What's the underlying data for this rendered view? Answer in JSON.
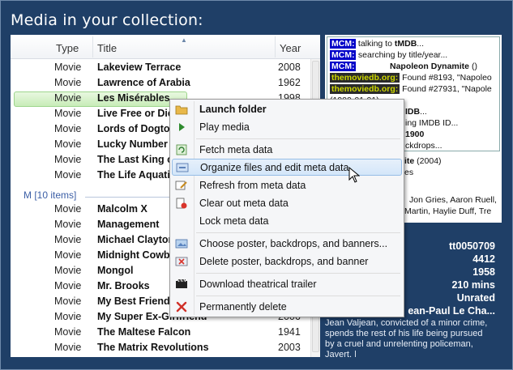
{
  "header": {
    "title": "Media in your collection:"
  },
  "list": {
    "columns": {
      "type": "Type",
      "title": "Title",
      "year": "Year"
    },
    "rows_top": [
      {
        "type": "Movie",
        "title": "Lakeview Terrace",
        "year": "2008"
      },
      {
        "type": "Movie",
        "title": "Lawrence of Arabia",
        "year": "1962"
      },
      {
        "type": "Movie",
        "title": "Les Misérables",
        "year": "1998"
      },
      {
        "type": "Movie",
        "title": "Live Free or Die",
        "year": ""
      },
      {
        "type": "Movie",
        "title": "Lords of Dogtown",
        "year": ""
      },
      {
        "type": "Movie",
        "title": "Lucky Number",
        "year": ""
      },
      {
        "type": "Movie",
        "title": "The Last King of",
        "year": ""
      },
      {
        "type": "Movie",
        "title": "The Life Aquatic",
        "year": ""
      }
    ],
    "group_label": "M [10 items]",
    "rows_bottom": [
      {
        "type": "Movie",
        "title": "Malcolm X",
        "year": ""
      },
      {
        "type": "Movie",
        "title": "Management",
        "year": ""
      },
      {
        "type": "Movie",
        "title": "Michael Clayton",
        "year": ""
      },
      {
        "type": "Movie",
        "title": "Midnight Cowboy",
        "year": ""
      },
      {
        "type": "Movie",
        "title": "Mongol",
        "year": ""
      },
      {
        "type": "Movie",
        "title": "Mr. Brooks",
        "year": ""
      },
      {
        "type": "Movie",
        "title": "My Best Friend",
        "year": ""
      },
      {
        "type": "Movie",
        "title": "My Super Ex-Girlfriend",
        "year": "2006"
      },
      {
        "type": "Movie",
        "title": "The Maltese Falcon",
        "year": "1941"
      },
      {
        "type": "Movie",
        "title": "The Matrix Revolutions",
        "year": "2003"
      }
    ]
  },
  "context_menu": {
    "items": [
      {
        "label": "Launch folder",
        "icon": "folder-icon"
      },
      {
        "label": "Play media",
        "icon": "play-icon"
      },
      {
        "label": "Fetch meta data",
        "icon": "refresh-icon"
      },
      {
        "label": "Organize files and edit meta data",
        "icon": "organize-icon"
      },
      {
        "label": "Refresh from meta data",
        "icon": "edit-icon"
      },
      {
        "label": "Clear out meta data",
        "icon": "clear-icon"
      },
      {
        "label": "Lock meta data",
        "icon": ""
      },
      {
        "label": "Choose poster, backdrops, and banners...",
        "icon": "poster-icon"
      },
      {
        "label": "Delete poster, backdrops, and banner",
        "icon": "delete-poster-icon"
      },
      {
        "label": "Download theatrical trailer",
        "icon": "film-icon"
      },
      {
        "label": "Permanently delete",
        "icon": "red-x-icon"
      }
    ]
  },
  "log": {
    "tag_mcm": "MCM:",
    "tag_tmdb": "themoviedb.org:",
    "lines": [
      {
        "tag": "MCM:",
        "text": " talking to ",
        "bold": "tMDB",
        "after": "..."
      },
      {
        "tag": "MCM:",
        "text": " searching by title/year...",
        "bold": "",
        "after": ""
      },
      {
        "tag": "MCM:",
        "text": "        ",
        "bold": "Napoleon Dynamite",
        "after": " ()"
      },
      {
        "tag": "themoviedb.org:",
        "text": " Found #8193, \"Napoleo",
        "bold": "",
        "after": ""
      },
      {
        "tag": "themoviedb.org:",
        "text": " Found #27931, \"Napole",
        "bold": "",
        "after": ""
      },
      {
        "tag": "",
        "text": "(1900-01-01)",
        "bold": "",
        "after": ""
      },
      {
        "tag": "",
        "text": "",
        "bold": "IDB",
        "after": "..."
      },
      {
        "tag": "",
        "text": "ing IMDB ID...",
        "bold": "",
        "after": ""
      },
      {
        "tag": "",
        "text": "",
        "bold": "1900",
        "after": ""
      },
      {
        "tag": "",
        "text": "ckdrops...",
        "bold": "",
        "after": ""
      }
    ]
  },
  "info": {
    "title_partial": "ite",
    "year_partial": " (2004)",
    "line2": "es",
    "cast1": "Jon Gries, Aaron Ruell,",
    "cast2": "Martin, Haylie Duff, Tre"
  },
  "details": {
    "imdb": "tt0050709",
    "num": "4412",
    "year": "1958",
    "runtime": "210 mins",
    "rating": "Unrated",
    "director": "ean-Paul Le Cha...",
    "plot1": "Jean Valjean, convicted of a minor crime,",
    "plot2": "spends the rest of his life being pursued",
    "plot3": "by a cruel and unrelenting policeman,",
    "plot4": "Javert. |"
  }
}
